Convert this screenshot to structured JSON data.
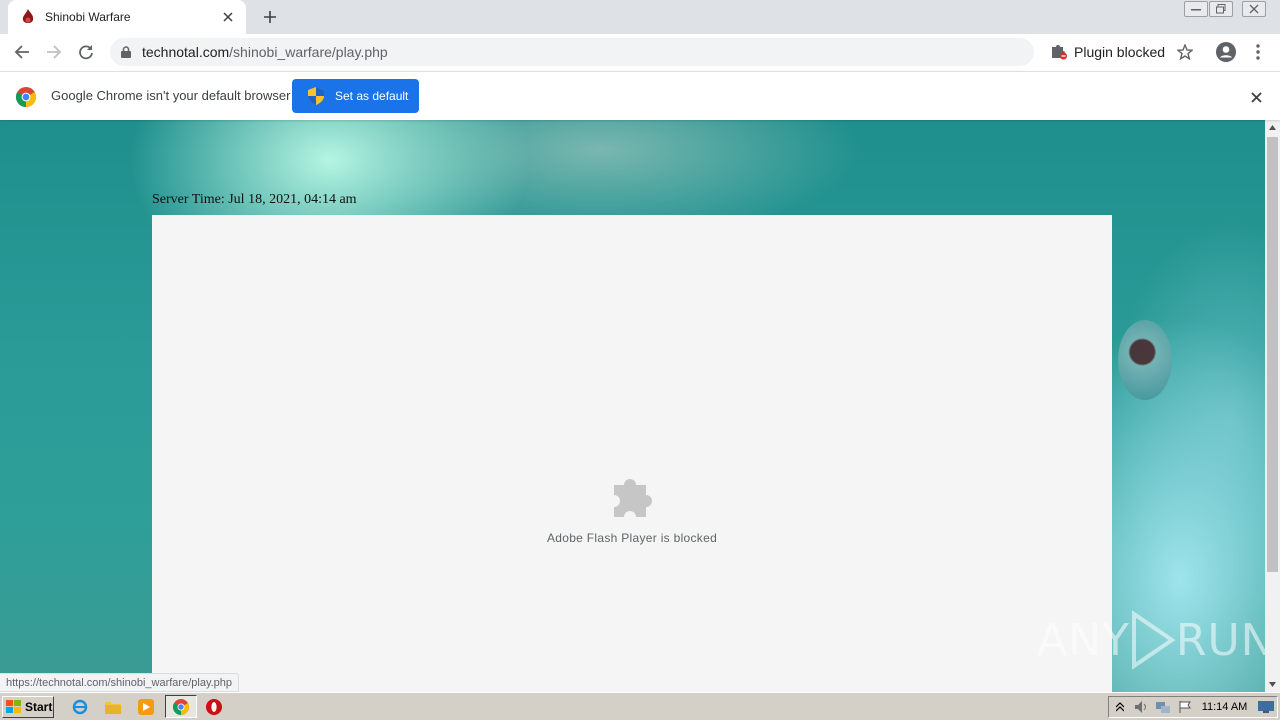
{
  "tab": {
    "title": "Shinobi Warfare"
  },
  "toolbar": {
    "url_host": "technotal.com",
    "url_path": "/shinobi_warfare/play.php",
    "plugin_blocked_label": "Plugin blocked"
  },
  "infobar": {
    "message": "Google Chrome isn't your default browser",
    "set_default_label": "Set as default"
  },
  "page": {
    "server_time": "Server Time: Jul 18, 2021, 04:14 am",
    "flash_message": "Adobe Flash Player is blocked",
    "watermark_text": "ANY",
    "watermark_text_2": "RUN",
    "status_url": "https://technotal.com/shinobi_warfare/play.php"
  },
  "taskbar": {
    "start_label": "Start",
    "clock": "11:14 AM"
  },
  "colors": {
    "accent": "#1a73e8",
    "page_background": "#2a9b97",
    "flash_box": "#f5f5f5"
  },
  "icons": [
    "favicon-flame-icon",
    "close-icon",
    "plus-icon",
    "back-icon",
    "forward-icon",
    "reload-icon",
    "lock-icon",
    "puzzle-blocked-icon",
    "star-icon",
    "profile-icon",
    "menu-dots-icon",
    "chrome-logo-icon",
    "shield-icon",
    "puzzle-icon",
    "windows-logo-icon",
    "ie-icon",
    "folder-icon",
    "media-player-icon",
    "chrome-icon",
    "opera-icon"
  ]
}
